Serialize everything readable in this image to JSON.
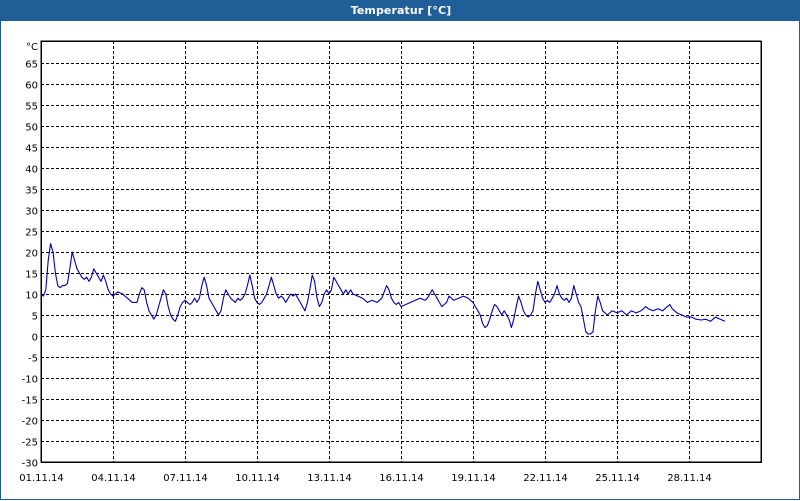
{
  "window": {
    "title": "Temperatur [°C]"
  },
  "colors": {
    "titlebar": "#1f5e96",
    "series": "#0000b0",
    "grid": "#000000"
  },
  "chart_data": {
    "type": "line",
    "title": "Temperatur [°C]",
    "ylabel": "°C",
    "xlabel": "",
    "ylim": [
      -30,
      70
    ],
    "xlim": [
      1,
      32
    ],
    "grid": true,
    "grid_style": "dashed",
    "legend": "none",
    "y_ticks": [
      "-30",
      "-25",
      "-20",
      "-15",
      "-10",
      "-5",
      "0",
      "5",
      "10",
      "15",
      "20",
      "25",
      "30",
      "35",
      "40",
      "45",
      "50",
      "55",
      "60",
      "65"
    ],
    "x_ticks": [
      {
        "x": 1,
        "label": "01.11.14"
      },
      {
        "x": 4,
        "label": "04.11.14"
      },
      {
        "x": 7,
        "label": "07.11.14"
      },
      {
        "x": 10,
        "label": "10.11.14"
      },
      {
        "x": 13,
        "label": "13.11.14"
      },
      {
        "x": 16,
        "label": "16.11.14"
      },
      {
        "x": 19,
        "label": "19.11.14"
      },
      {
        "x": 22,
        "label": "22.11.14"
      },
      {
        "x": 25,
        "label": "25.11.14"
      },
      {
        "x": 28,
        "label": "28.11.14"
      }
    ],
    "series": [
      {
        "points": [
          [
            1.0,
            10
          ],
          [
            1.1,
            9.5
          ],
          [
            1.2,
            11
          ],
          [
            1.3,
            18
          ],
          [
            1.4,
            22
          ],
          [
            1.5,
            20
          ],
          [
            1.6,
            15
          ],
          [
            1.7,
            12
          ],
          [
            1.8,
            11.5
          ],
          [
            1.9,
            12
          ],
          [
            2.0,
            12
          ],
          [
            2.1,
            12.5
          ],
          [
            2.2,
            16
          ],
          [
            2.3,
            20
          ],
          [
            2.4,
            18
          ],
          [
            2.5,
            16
          ],
          [
            2.6,
            15
          ],
          [
            2.7,
            14
          ],
          [
            2.8,
            13.5
          ],
          [
            2.9,
            14
          ],
          [
            3.0,
            13
          ],
          [
            3.1,
            14
          ],
          [
            3.2,
            16
          ],
          [
            3.3,
            15
          ],
          [
            3.4,
            14
          ],
          [
            3.5,
            13
          ],
          [
            3.6,
            14.5
          ],
          [
            3.7,
            13
          ],
          [
            3.8,
            11
          ],
          [
            3.9,
            10
          ],
          [
            4.0,
            9.5
          ],
          [
            4.2,
            10.5
          ],
          [
            4.4,
            10
          ],
          [
            4.6,
            9
          ],
          [
            4.8,
            8
          ],
          [
            5.0,
            8
          ],
          [
            5.1,
            10
          ],
          [
            5.2,
            11.5
          ],
          [
            5.3,
            11
          ],
          [
            5.4,
            8
          ],
          [
            5.5,
            6
          ],
          [
            5.6,
            5
          ],
          [
            5.7,
            4
          ],
          [
            5.8,
            5
          ],
          [
            5.9,
            7
          ],
          [
            6.0,
            9
          ],
          [
            6.1,
            11
          ],
          [
            6.2,
            10
          ],
          [
            6.3,
            7
          ],
          [
            6.4,
            5
          ],
          [
            6.5,
            4
          ],
          [
            6.6,
            3.5
          ],
          [
            6.7,
            5
          ],
          [
            6.8,
            7
          ],
          [
            6.9,
            8
          ],
          [
            7.0,
            8.5
          ],
          [
            7.1,
            8
          ],
          [
            7.2,
            7.5
          ],
          [
            7.3,
            8
          ],
          [
            7.4,
            9
          ],
          [
            7.5,
            8
          ],
          [
            7.6,
            9
          ],
          [
            7.7,
            12
          ],
          [
            7.8,
            14
          ],
          [
            7.9,
            12
          ],
          [
            8.0,
            9
          ],
          [
            8.1,
            8
          ],
          [
            8.2,
            7
          ],
          [
            8.3,
            6
          ],
          [
            8.4,
            5
          ],
          [
            8.5,
            6
          ],
          [
            8.6,
            9
          ],
          [
            8.7,
            11
          ],
          [
            8.8,
            10
          ],
          [
            8.9,
            9
          ],
          [
            9.0,
            8.5
          ],
          [
            9.1,
            8
          ],
          [
            9.2,
            9
          ],
          [
            9.3,
            8.5
          ],
          [
            9.4,
            9
          ],
          [
            9.5,
            10
          ],
          [
            9.6,
            12
          ],
          [
            9.7,
            14.5
          ],
          [
            9.8,
            12
          ],
          [
            9.9,
            9
          ],
          [
            10.0,
            8
          ],
          [
            10.1,
            7.5
          ],
          [
            10.2,
            8
          ],
          [
            10.3,
            9
          ],
          [
            10.4,
            10
          ],
          [
            10.5,
            12
          ],
          [
            10.6,
            14
          ],
          [
            10.7,
            12
          ],
          [
            10.8,
            10
          ],
          [
            10.9,
            9
          ],
          [
            11.0,
            9.5
          ],
          [
            11.1,
            9
          ],
          [
            11.2,
            8
          ],
          [
            11.3,
            9
          ],
          [
            11.4,
            10
          ],
          [
            11.5,
            9.5
          ],
          [
            11.6,
            10
          ],
          [
            11.7,
            9
          ],
          [
            11.8,
            8
          ],
          [
            11.9,
            7
          ],
          [
            12.0,
            6
          ],
          [
            12.1,
            8
          ],
          [
            12.2,
            11
          ],
          [
            12.3,
            14.5
          ],
          [
            12.4,
            13
          ],
          [
            12.5,
            9
          ],
          [
            12.6,
            7
          ],
          [
            12.7,
            8
          ],
          [
            12.8,
            10
          ],
          [
            12.9,
            11
          ],
          [
            13.0,
            10
          ],
          [
            13.1,
            11
          ],
          [
            13.2,
            14
          ],
          [
            13.3,
            13
          ],
          [
            13.4,
            12
          ],
          [
            13.5,
            11
          ],
          [
            13.6,
            10
          ],
          [
            13.7,
            11
          ],
          [
            13.8,
            10
          ],
          [
            13.9,
            11
          ],
          [
            14.0,
            10
          ],
          [
            14.2,
            9.5
          ],
          [
            14.4,
            9
          ],
          [
            14.6,
            8
          ],
          [
            14.8,
            8.5
          ],
          [
            15.0,
            8
          ],
          [
            15.1,
            8.5
          ],
          [
            15.2,
            9
          ],
          [
            15.3,
            10.5
          ],
          [
            15.4,
            12
          ],
          [
            15.5,
            11
          ],
          [
            15.6,
            9
          ],
          [
            15.7,
            8
          ],
          [
            15.8,
            7.5
          ],
          [
            15.9,
            8
          ],
          [
            16.0,
            7
          ],
          [
            16.2,
            7.5
          ],
          [
            16.4,
            8
          ],
          [
            16.6,
            8.5
          ],
          [
            16.8,
            9
          ],
          [
            17.0,
            8.5
          ],
          [
            17.1,
            9
          ],
          [
            17.2,
            10
          ],
          [
            17.3,
            11
          ],
          [
            17.4,
            10
          ],
          [
            17.5,
            9
          ],
          [
            17.6,
            8
          ],
          [
            17.7,
            7
          ],
          [
            17.8,
            7.5
          ],
          [
            17.9,
            8
          ],
          [
            18.0,
            9.5
          ],
          [
            18.1,
            9
          ],
          [
            18.2,
            8.5
          ],
          [
            18.4,
            9
          ],
          [
            18.6,
            9.5
          ],
          [
            18.8,
            9
          ],
          [
            19.0,
            8
          ],
          [
            19.1,
            7
          ],
          [
            19.2,
            6
          ],
          [
            19.3,
            5
          ],
          [
            19.4,
            3
          ],
          [
            19.5,
            2
          ],
          [
            19.6,
            2.5
          ],
          [
            19.7,
            4
          ],
          [
            19.8,
            6
          ],
          [
            19.9,
            7.5
          ],
          [
            20.0,
            7
          ],
          [
            20.1,
            6
          ],
          [
            20.2,
            5
          ],
          [
            20.3,
            6
          ],
          [
            20.4,
            5
          ],
          [
            20.5,
            4
          ],
          [
            20.6,
            2
          ],
          [
            20.7,
            4
          ],
          [
            20.8,
            7
          ],
          [
            20.9,
            9.5
          ],
          [
            21.0,
            8
          ],
          [
            21.1,
            6
          ],
          [
            21.2,
            5
          ],
          [
            21.3,
            4.5
          ],
          [
            21.4,
            5
          ],
          [
            21.5,
            6
          ],
          [
            21.6,
            10
          ],
          [
            21.7,
            13
          ],
          [
            21.8,
            11
          ],
          [
            21.9,
            9
          ],
          [
            22.0,
            8
          ],
          [
            22.1,
            8.5
          ],
          [
            22.2,
            8
          ],
          [
            22.3,
            9
          ],
          [
            22.4,
            10
          ],
          [
            22.5,
            12
          ],
          [
            22.6,
            10
          ],
          [
            22.7,
            9
          ],
          [
            22.8,
            8.5
          ],
          [
            22.9,
            9
          ],
          [
            23.0,
            8
          ],
          [
            23.1,
            9
          ],
          [
            23.2,
            12
          ],
          [
            23.3,
            10
          ],
          [
            23.4,
            8
          ],
          [
            23.5,
            7
          ],
          [
            23.6,
            4
          ],
          [
            23.7,
            1
          ],
          [
            23.8,
            0.5
          ],
          [
            23.9,
            0.5
          ],
          [
            24.0,
            1
          ],
          [
            24.1,
            6
          ],
          [
            24.2,
            9.5
          ],
          [
            24.3,
            8
          ],
          [
            24.4,
            6
          ],
          [
            24.6,
            5
          ],
          [
            24.8,
            6
          ],
          [
            25.0,
            5.5
          ],
          [
            25.2,
            6
          ],
          [
            25.4,
            5
          ],
          [
            25.6,
            6
          ],
          [
            25.8,
            5.5
          ],
          [
            26.0,
            6
          ],
          [
            26.1,
            6.5
          ],
          [
            26.2,
            7
          ],
          [
            26.3,
            6.5
          ],
          [
            26.5,
            6
          ],
          [
            26.7,
            6.5
          ],
          [
            26.9,
            6
          ],
          [
            27.0,
            6.5
          ],
          [
            27.1,
            7
          ],
          [
            27.2,
            7.5
          ],
          [
            27.3,
            6.5
          ],
          [
            27.5,
            5.5
          ],
          [
            27.7,
            5
          ],
          [
            27.9,
            4.5
          ],
          [
            28.1,
            4.5
          ],
          [
            28.3,
            4
          ],
          [
            28.5,
            3.8
          ],
          [
            28.7,
            4
          ],
          [
            28.9,
            3.5
          ],
          [
            29.1,
            4.5
          ],
          [
            29.3,
            4
          ],
          [
            29.5,
            3.5
          ]
        ]
      }
    ]
  }
}
